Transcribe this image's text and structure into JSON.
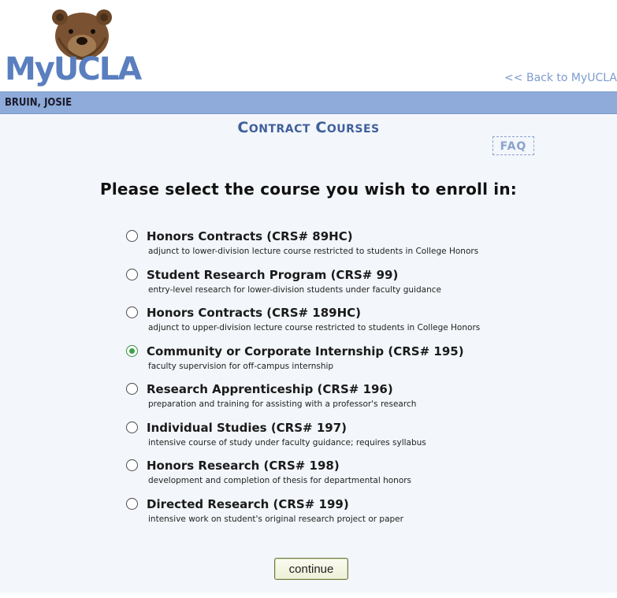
{
  "header": {
    "logo_text": "MyUCLA",
    "back_link": "<< Back to MyUCLA"
  },
  "user": {
    "name": "BRUIN, JOSIE"
  },
  "page": {
    "title_first_cap": "C",
    "title_first_rest": "ONTRACT",
    "title_second_cap": "C",
    "title_second_rest": "OURSES",
    "faq_label": "FAQ",
    "prompt": "Please select the course you wish to enroll in:"
  },
  "courses": [
    {
      "title": "Honors Contracts (CRS# 89HC)",
      "description": "adjunct to lower-division lecture course restricted to students in College Honors",
      "selected": false
    },
    {
      "title": "Student Research Program (CRS# 99)",
      "description": "entry-level research for lower-division students under faculty guidance",
      "selected": false
    },
    {
      "title": "Honors Contracts (CRS# 189HC)",
      "description": "adjunct to upper-division lecture course restricted to students in College Honors",
      "selected": false
    },
    {
      "title": "Community or Corporate Internship (CRS# 195)",
      "description": "faculty supervision for off-campus internship",
      "selected": true
    },
    {
      "title": "Research Apprenticeship (CRS# 196)",
      "description": "preparation and training for assisting with a professor's research",
      "selected": false
    },
    {
      "title": "Individual Studies (CRS# 197)",
      "description": "intensive course of study under faculty guidance; requires syllabus",
      "selected": false
    },
    {
      "title": "Honors Research (CRS# 198)",
      "description": "development and completion of thesis for departmental honors",
      "selected": false
    },
    {
      "title": "Directed Research (CRS# 199)",
      "description": "intensive work on student's original research project or paper",
      "selected": false
    }
  ],
  "actions": {
    "continue_label": "continue"
  },
  "colors": {
    "user_bar": "#8eabd9",
    "title_blue": "#3f5f9c",
    "logo_blue": "#5a7fbf",
    "content_bg": "#f3f6fa",
    "selected_radio": "#3aa347"
  },
  "icons": {
    "logo": "bear-logo-icon",
    "radio": "radio-button-icon"
  }
}
